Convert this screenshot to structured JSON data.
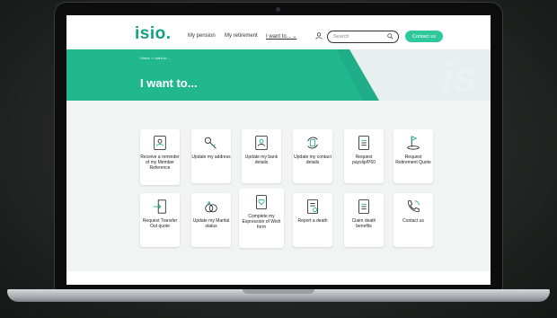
{
  "logo": "isio.",
  "nav": {
    "items": [
      "My pension",
      "My retirement",
      "I want to...  ⌄"
    ],
    "contact_label": "Contact us"
  },
  "search": {
    "placeholder": "Search"
  },
  "hero": {
    "breadcrumb": "Home  ›  I want to...",
    "title": "I want to...",
    "watermark": "is"
  },
  "cards": [
    {
      "label": "Receive a reminder of my Member Reference",
      "icon": "member-reference-icon"
    },
    {
      "label": "Update my address",
      "icon": "keys-icon"
    },
    {
      "label": "Update my bank details",
      "icon": "bank-details-icon"
    },
    {
      "label": "Update my contact details",
      "icon": "contact-update-icon"
    },
    {
      "label": "Request payslip/P60",
      "icon": "payslip-icon"
    },
    {
      "label": "Request Retirement Quote",
      "icon": "golf-flag-icon"
    },
    {
      "label": "Request Transfer Out quote",
      "icon": "transfer-out-icon"
    },
    {
      "label": "Update my Marital status",
      "icon": "rings-icon"
    },
    {
      "label": "Complete my Expression of Wish form",
      "icon": "expression-of-wish-icon"
    },
    {
      "label": "Report a death",
      "icon": "report-death-icon"
    },
    {
      "label": "Claim death benefits",
      "icon": "death-benefits-icon"
    },
    {
      "label": "Contact us",
      "icon": "phone-icon"
    }
  ],
  "colors": {
    "brand": "#10a37f",
    "hero": "#22b88e",
    "button": "#2fc89c"
  }
}
